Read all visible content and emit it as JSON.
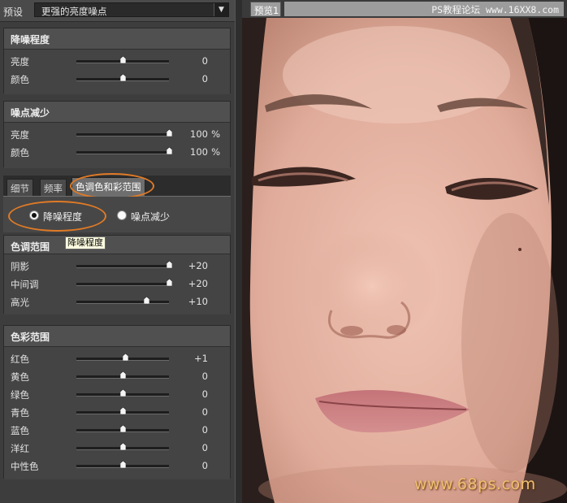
{
  "preset": {
    "label": "预设",
    "value": "更强的亮度噪点"
  },
  "noise_level": {
    "title": "降噪程度",
    "rows": [
      {
        "label": "亮度",
        "value": "0",
        "unit": "",
        "fraction": 0.5
      },
      {
        "label": "颜色",
        "value": "0",
        "unit": "",
        "fraction": 0.5
      }
    ]
  },
  "noise_reduce": {
    "title": "噪点减少",
    "rows": [
      {
        "label": "亮度",
        "value": "100",
        "unit": "%",
        "fraction": 1.0
      },
      {
        "label": "颜色",
        "value": "100",
        "unit": "%",
        "fraction": 1.0
      }
    ]
  },
  "tabs": [
    {
      "label": "细节"
    },
    {
      "label": "频率"
    },
    {
      "label": "色调色和彩范围"
    }
  ],
  "radios": [
    {
      "label": "降噪程度",
      "checked": true
    },
    {
      "label": "噪点减少",
      "checked": false
    }
  ],
  "tooltip": "降噪程度",
  "tone_range": {
    "title": "色调范围",
    "rows": [
      {
        "label": "阴影",
        "value": "+20",
        "unit": "",
        "fraction": 1.0
      },
      {
        "label": "中间调",
        "value": "+20",
        "unit": "",
        "fraction": 1.0
      },
      {
        "label": "高光",
        "value": "+10",
        "unit": "",
        "fraction": 0.75
      }
    ]
  },
  "color_range": {
    "title": "色彩范围",
    "rows": [
      {
        "label": "红色",
        "value": "+1",
        "unit": "",
        "fraction": 0.53
      },
      {
        "label": "黄色",
        "value": "0",
        "unit": "",
        "fraction": 0.5
      },
      {
        "label": "绿色",
        "value": "0",
        "unit": "",
        "fraction": 0.5
      },
      {
        "label": "青色",
        "value": "0",
        "unit": "",
        "fraction": 0.5
      },
      {
        "label": "蓝色",
        "value": "0",
        "unit": "",
        "fraction": 0.5
      },
      {
        "label": "洋红",
        "value": "0",
        "unit": "",
        "fraction": 0.5
      },
      {
        "label": "中性色",
        "value": "0",
        "unit": "",
        "fraction": 0.5
      }
    ]
  },
  "preview": {
    "tab_label": "预览1",
    "site_mark": "PS教程论坛 www.16XX8.com",
    "watermark": "www.68ps.com"
  },
  "colors": {
    "annotation": "#e07a26",
    "panel": "#444444",
    "skin": "#e4b4a4"
  }
}
